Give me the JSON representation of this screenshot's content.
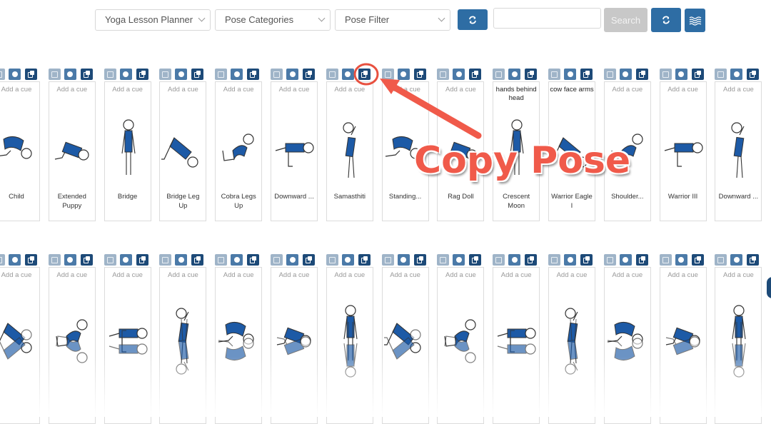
{
  "toolbar": {
    "lesson_select": "Yoga Lesson Planner",
    "category_select": "Pose Categories",
    "filter_select": "Pose Filter",
    "search_value": "",
    "search_label": "Search",
    "icons": {
      "refresh1": "refresh-icon",
      "refresh2": "refresh-icon",
      "waves": "waves-icon"
    },
    "colors": {
      "primary": "#2e6da4",
      "disabled": "#c8c8c8"
    }
  },
  "card_actions": {
    "edit": "edit-icon",
    "delete": "remove-icon",
    "copy": "copy-icon"
  },
  "row1": [
    {
      "cue": "Add a cue",
      "cue_filled": false,
      "name": "Child"
    },
    {
      "cue": "Add a cue",
      "cue_filled": false,
      "name": "Extended Puppy"
    },
    {
      "cue": "Add a cue",
      "cue_filled": false,
      "name": "Bridge"
    },
    {
      "cue": "Add a cue",
      "cue_filled": false,
      "name": "Bridge Leg Up"
    },
    {
      "cue": "Add a cue",
      "cue_filled": false,
      "name": "Cobra Legs Up"
    },
    {
      "cue": "Add a cue",
      "cue_filled": false,
      "name": "Downward ..."
    },
    {
      "cue": "Add a cue",
      "cue_filled": false,
      "name": "Samasthiti"
    },
    {
      "cue": "Add a cue",
      "cue_filled": false,
      "name": "Standing..."
    },
    {
      "cue": "Add a cue",
      "cue_filled": false,
      "name": "Rag Doll"
    },
    {
      "cue": "hands behind head",
      "cue_filled": true,
      "name": "Crescent Moon"
    },
    {
      "cue": "cow face arms",
      "cue_filled": true,
      "name": "Warrior Eagle I"
    },
    {
      "cue": "Add a cue",
      "cue_filled": false,
      "name": "Shoulder..."
    },
    {
      "cue": "Add a cue",
      "cue_filled": false,
      "name": "Warrior III"
    },
    {
      "cue": "Add a cue",
      "cue_filled": false,
      "name": "Downward ..."
    }
  ],
  "row2": [
    {
      "cue": "Add a cue"
    },
    {
      "cue": "Add a cue"
    },
    {
      "cue": "Add a cue"
    },
    {
      "cue": "Add a cue"
    },
    {
      "cue": "Add a cue"
    },
    {
      "cue": "Add a cue"
    },
    {
      "cue": "Add a cue"
    },
    {
      "cue": "Add a cue"
    },
    {
      "cue": "Add a cue"
    },
    {
      "cue": "Add a cue"
    },
    {
      "cue": "Add a cue"
    },
    {
      "cue": "Add a cue"
    },
    {
      "cue": "Add a cue"
    },
    {
      "cue": "Add a cue"
    }
  ],
  "annotation": {
    "text": "Copy Pose",
    "color": "#f05a4a"
  }
}
